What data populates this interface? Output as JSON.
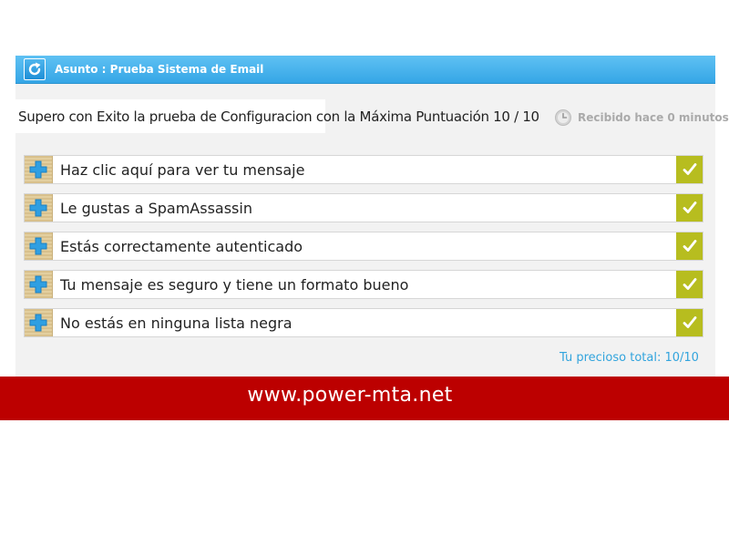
{
  "header": {
    "subject": "Asunto : Prueba Sistema de Email",
    "refresh_icon": "refresh-icon"
  },
  "score_message": "Supero con Exito la prueba de Configuracion con la Máxima Puntuación 10 / 10",
  "received": {
    "text": "Recibido hace 0 minutos",
    "icon": "clock-icon"
  },
  "checks": [
    {
      "label": "Haz clic aquí para ver tu mensaje",
      "passed": true
    },
    {
      "label": "Le gustas a SpamAssassin",
      "passed": true
    },
    {
      "label": "Estás correctamente autenticado",
      "passed": true
    },
    {
      "label": "Tu mensaje es seguro y tiene un formato bueno",
      "passed": true
    },
    {
      "label": "No estás en ninguna lista negra",
      "passed": true
    }
  ],
  "total": "Tu precioso total: 10/10",
  "banner": {
    "text": "www.power-mta.net"
  },
  "colors": {
    "header_blue": "#35a6e6",
    "check_green": "#b7bd1f",
    "plus_blue": "#2f9fe2",
    "total_blue": "#32a4dd",
    "banner_red": "#bc0000"
  }
}
